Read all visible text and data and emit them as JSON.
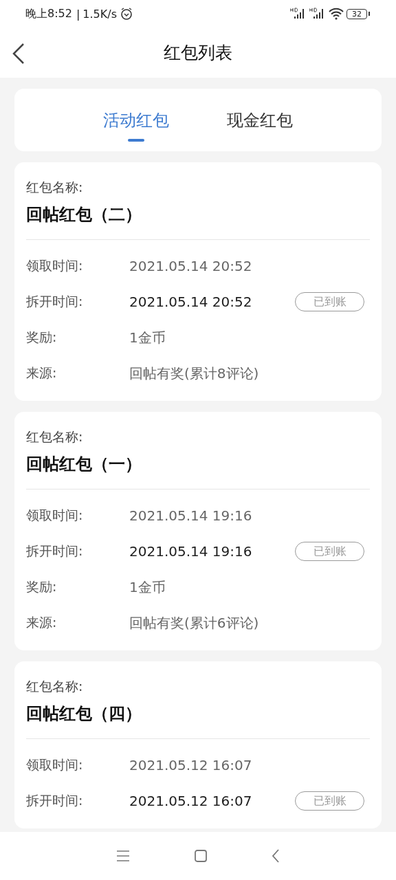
{
  "status_bar": {
    "time": "晚上8:52",
    "separator": "|",
    "speed": "1.5K/s",
    "battery": "32"
  },
  "header": {
    "title": "红包列表"
  },
  "tabs": [
    {
      "label": "活动红包",
      "selected": true
    },
    {
      "label": "现金红包",
      "selected": false
    }
  ],
  "cards": [
    {
      "name_label": "红包名称:",
      "name": "回帖红包（二）",
      "rows": [
        {
          "label": "领取时间:",
          "value": "2021.05.14 20:52",
          "strong": false
        },
        {
          "label": "拆开时间:",
          "value": "2021.05.14 20:52",
          "strong": true,
          "badge": "已到账"
        },
        {
          "label": "奖励:",
          "value": "1金币",
          "strong": false
        },
        {
          "label": "来源:",
          "value": "回帖有奖(累计8评论)",
          "strong": false
        }
      ]
    },
    {
      "name_label": "红包名称:",
      "name": "回帖红包（一）",
      "rows": [
        {
          "label": "领取时间:",
          "value": "2021.05.14 19:16",
          "strong": false
        },
        {
          "label": "拆开时间:",
          "value": "2021.05.14 19:16",
          "strong": true,
          "badge": "已到账"
        },
        {
          "label": "奖励:",
          "value": "1金币",
          "strong": false
        },
        {
          "label": "来源:",
          "value": "回帖有奖(累计6评论)",
          "strong": false
        }
      ]
    },
    {
      "name_label": "红包名称:",
      "name": "回帖红包（四）",
      "rows": [
        {
          "label": "领取时间:",
          "value": "2021.05.12 16:07",
          "strong": false
        },
        {
          "label": "拆开时间:",
          "value": "2021.05.12 16:07",
          "strong": true,
          "badge": "已到账"
        }
      ]
    }
  ]
}
